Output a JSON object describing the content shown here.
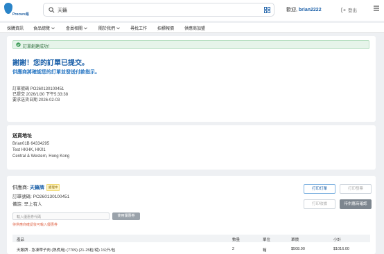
{
  "header": {
    "logo_text": "Procure易",
    "search_value": "天籟",
    "welcome_prefix": "歡迎,",
    "username": "brian2222",
    "logout_label": "登出"
  },
  "nav": {
    "items": [
      "採購資訊",
      "食品總覽",
      "會員相關",
      "關於我們",
      "尋找工作",
      "招標報價",
      "供應商加盟"
    ]
  },
  "order": {
    "alert": "訂單創建成功！",
    "thanks": "謝謝！您的訂單已提交。",
    "subtitle": "供應商將確認您的訂單並發送付款指示。",
    "order_no": "訂單號碼  PO260130100451",
    "submitted": "已提交  2026/1/30 下午5:33:38",
    "delivery_date": "要求送貨日期  2026-02-03"
  },
  "shipping": {
    "title": "送貨地址",
    "line1": "Brian01B 64334295",
    "line2": "Test HKHK, HK01",
    "line3": "Central & Western, Hong Kong"
  },
  "supplier": {
    "label": "供應商:",
    "name": "天籟牌",
    "badge": "處理中",
    "order_no": "訂單號碼: PO260130100451",
    "remark": "備註: 早上有人",
    "buttons": {
      "print_order": "打印訂單",
      "print_invoice": "打印發票",
      "print_receipt": "打印收據",
      "pending": "待供應商確認"
    },
    "coupon_placeholder": "輸入優惠券代碼",
    "coupon_button": "使用優惠券",
    "coupon_note": "待供應商確認後可輸入優惠券"
  },
  "table": {
    "headers": [
      "產品",
      "數量",
      "單位",
      "單價",
      "小計"
    ],
    "rows": [
      [
        "天籟牌 - 急凍帶子肉 (熟煮用) (7709) (21-25粒/磅) 1公斤/包",
        "2",
        "箱",
        "$508.00",
        "$1016.00"
      ]
    ]
  }
}
